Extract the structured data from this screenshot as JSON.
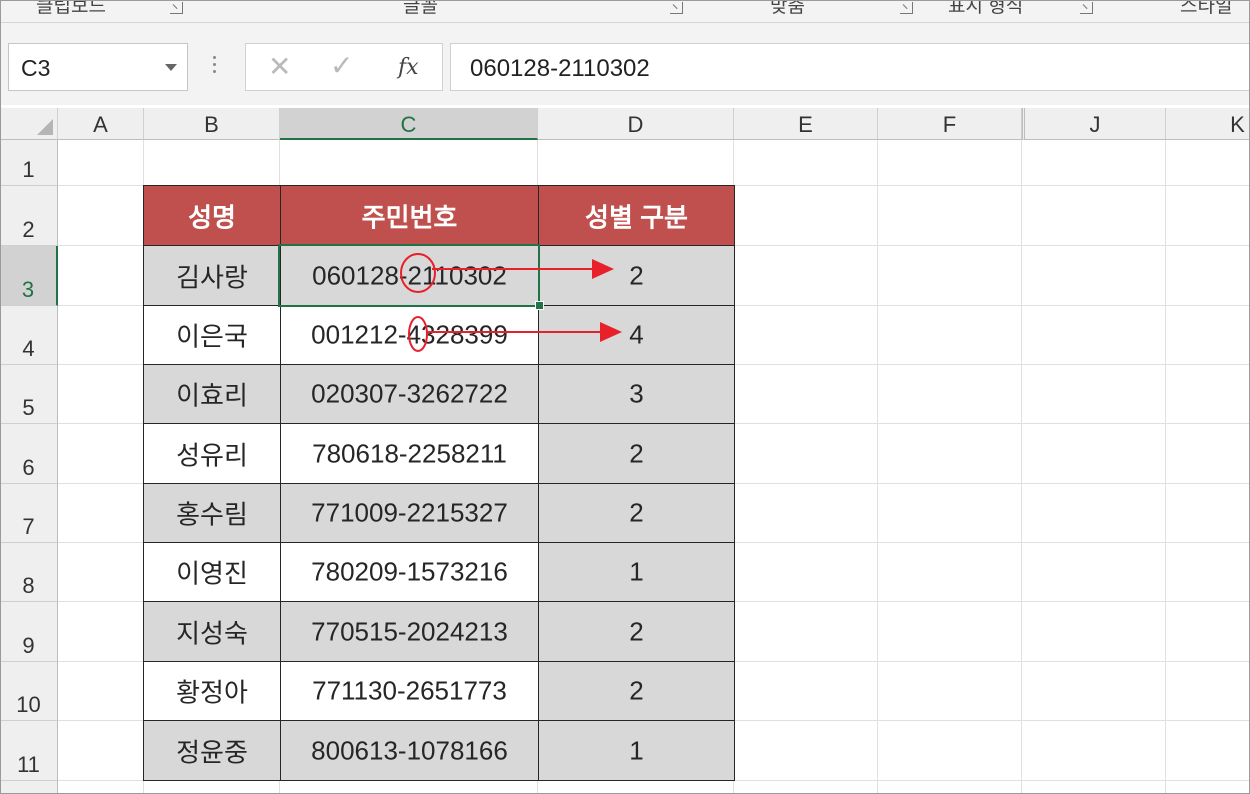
{
  "ribbon": {
    "groups": [
      "클립보드",
      "글꼴",
      "맞춤",
      "표시 형식",
      "스타일"
    ]
  },
  "formula_bar": {
    "name_box": "C3",
    "cancel_icon": "✕",
    "enter_icon": "✓",
    "function_icon": "fx",
    "content": "060128-2110302"
  },
  "sheet": {
    "columns": [
      "A",
      "B",
      "C",
      "D",
      "E",
      "F",
      "J",
      "K"
    ],
    "selected_column": "C",
    "rows": [
      "1",
      "2",
      "3",
      "4",
      "5",
      "6",
      "7",
      "8",
      "9",
      "10",
      "11"
    ],
    "selected_row": "3",
    "active_cell": "C3"
  },
  "table": {
    "headers": [
      "성명",
      "주민번호",
      "성별 구분"
    ],
    "rows": [
      {
        "name": "김사랑",
        "id": "060128-2110302",
        "gender": "2"
      },
      {
        "name": "이은국",
        "id": "001212-4328399",
        "gender": "4"
      },
      {
        "name": "이효리",
        "id": "020307-3262722",
        "gender": "3"
      },
      {
        "name": "성유리",
        "id": "780618-2258211",
        "gender": "2"
      },
      {
        "name": "홍수림",
        "id": "771009-2215327",
        "gender": "2"
      },
      {
        "name": "이영진",
        "id": "780209-1573216",
        "gender": "1"
      },
      {
        "name": "지성숙",
        "id": "770515-2024213",
        "gender": "2"
      },
      {
        "name": "황정아",
        "id": "771130-2651773",
        "gender": "2"
      },
      {
        "name": "정윤중",
        "id": "800613-1078166",
        "gender": "1"
      }
    ]
  },
  "colors": {
    "header_fill": "#c0504d",
    "shaded_fill": "#d8d8d8",
    "selection": "#217346",
    "annotation": "#e8202a"
  }
}
